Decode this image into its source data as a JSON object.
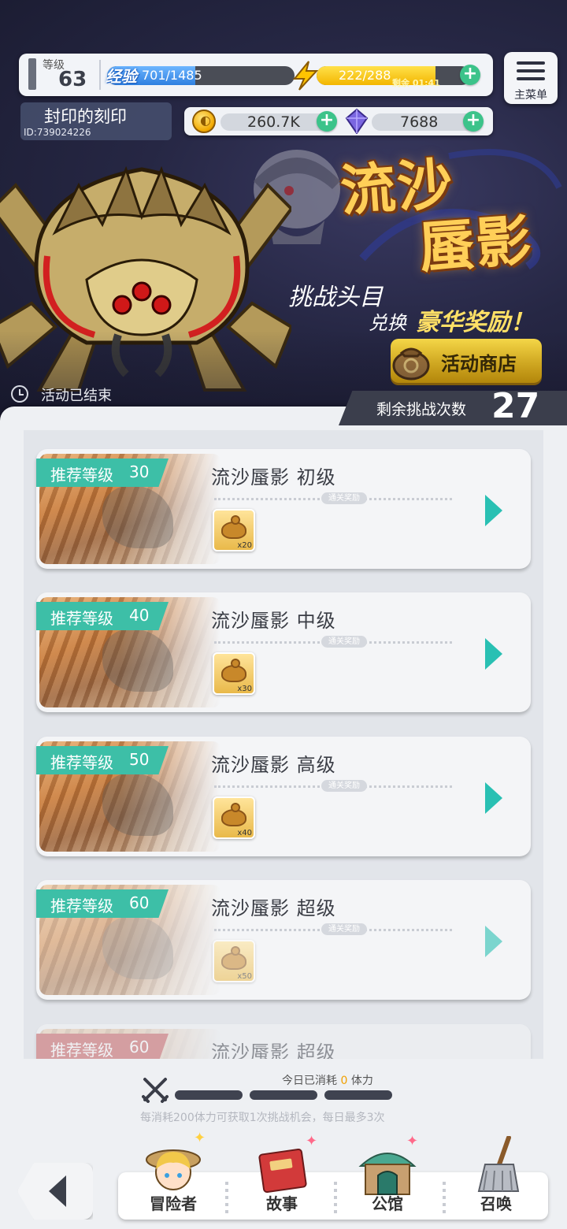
{
  "player": {
    "level_label": "等级",
    "level": "63",
    "exp_label": "经验",
    "exp": "701/1485",
    "exp_fraction": 0.47,
    "stamina": "222/288",
    "stamina_fraction": 0.77,
    "stamina_timer": "剩余 01:41",
    "name": "封印的刻印",
    "id": "ID:739024226"
  },
  "currency": {
    "gold": "260.7K",
    "gems": "7688"
  },
  "menu": {
    "label": "主菜单"
  },
  "event": {
    "title_line1": "流沙",
    "title_line2": "蜃影",
    "slogan1": "挑战头目",
    "slogan2a": "兑换",
    "slogan2b": "豪华奖励！",
    "shop_label": "活动商店",
    "status": "活动已结束",
    "remaining_label": "剩余挑战次数",
    "remaining": "27"
  },
  "stages": [
    {
      "rec_label": "推荐等级",
      "rec_level": "30",
      "title": "流沙蜃影 初级",
      "reward_tag": "通关奖励",
      "reward_count": "x20"
    },
    {
      "rec_label": "推荐等级",
      "rec_level": "40",
      "title": "流沙蜃影 中级",
      "reward_tag": "通关奖励",
      "reward_count": "x30"
    },
    {
      "rec_label": "推荐等级",
      "rec_level": "50",
      "title": "流沙蜃影 高级",
      "reward_tag": "通关奖励",
      "reward_count": "x40"
    },
    {
      "rec_label": "推荐等级",
      "rec_level": "60",
      "title": "流沙蜃影 超级",
      "reward_tag": "通关奖励",
      "reward_count": "x50"
    },
    {
      "rec_label": "推荐等级",
      "rec_level": "60",
      "title": "流沙蜃影 超级"
    }
  ],
  "footer": {
    "consume_prefix": "今日已消耗",
    "consume_value": "0",
    "consume_suffix": "体力",
    "rule": "每消耗200体力可获取1次挑战机会，每日最多3次"
  },
  "nav": {
    "items": [
      {
        "label": "冒险者"
      },
      {
        "label": "故事"
      },
      {
        "label": "公馆"
      },
      {
        "label": "召唤"
      }
    ]
  },
  "colors": {
    "accent_teal": "#3dbfa7",
    "gold_button": "#f7b800",
    "banner_bg": "#262744"
  }
}
